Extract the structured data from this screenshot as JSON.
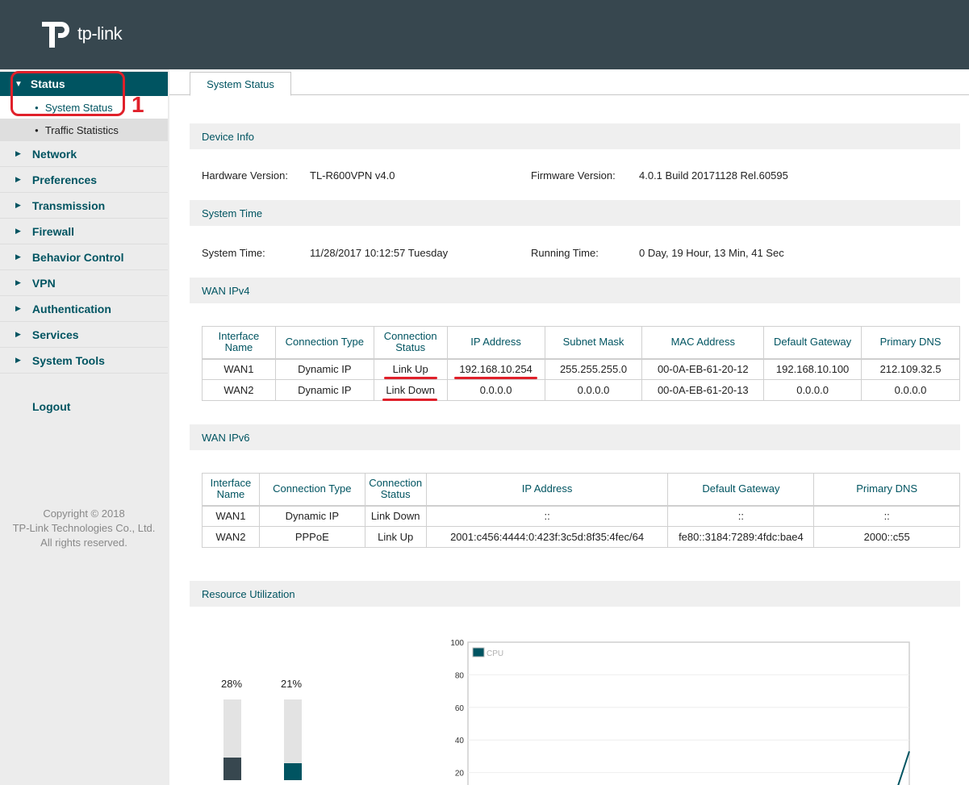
{
  "brand": {
    "name": "tp-link"
  },
  "sidebar": {
    "status": {
      "label": "Status",
      "items": [
        {
          "label": "System Status"
        },
        {
          "label": "Traffic Statistics"
        }
      ]
    },
    "items": [
      {
        "label": "Network"
      },
      {
        "label": "Preferences"
      },
      {
        "label": "Transmission"
      },
      {
        "label": "Firewall"
      },
      {
        "label": "Behavior Control"
      },
      {
        "label": "VPN"
      },
      {
        "label": "Authentication"
      },
      {
        "label": "Services"
      },
      {
        "label": "System Tools"
      }
    ],
    "logout": "Logout",
    "copyright": [
      "Copyright © 2018",
      "TP-Link Technologies Co., Ltd.",
      "All rights reserved."
    ]
  },
  "annotation": {
    "number": "1",
    "color": "#e0202a"
  },
  "tabs": [
    {
      "label": "System Status"
    }
  ],
  "device_info": {
    "title": "Device Info",
    "hardware_label": "Hardware Version:",
    "hardware_value": "TL-R600VPN v4.0",
    "firmware_label": "Firmware Version:",
    "firmware_value": "4.0.1 Build 20171128 Rel.60595"
  },
  "system_time": {
    "title": "System Time",
    "time_label": "System Time:",
    "time_value": "11/28/2017 10:12:57 Tuesday",
    "running_label": "Running Time:",
    "running_value": "0 Day, 19 Hour, 13 Min, 41 Sec"
  },
  "wan_ipv4": {
    "title": "WAN IPv4",
    "headers": [
      [
        "Interface",
        "Name"
      ],
      [
        "Connection Type"
      ],
      [
        "Connection",
        "Status"
      ],
      [
        "IP Address"
      ],
      [
        "Subnet Mask"
      ],
      [
        "MAC Address"
      ],
      [
        "Default Gateway"
      ],
      [
        "Primary DNS"
      ]
    ],
    "rows": [
      [
        "WAN1",
        "Dynamic IP",
        "Link Up",
        "192.168.10.254",
        "255.255.255.0",
        "00-0A-EB-61-20-12",
        "192.168.10.100",
        "212.109.32.5"
      ],
      [
        "WAN2",
        "Dynamic IP",
        "Link Down",
        "0.0.0.0",
        "0.0.0.0",
        "00-0A-EB-61-20-13",
        "0.0.0.0",
        "0.0.0.0"
      ]
    ]
  },
  "wan_ipv6": {
    "title": "WAN IPv6",
    "headers": [
      [
        "Interface",
        "Name"
      ],
      [
        "Connection Type"
      ],
      [
        "Connection",
        "Status"
      ],
      [
        "IP Address"
      ],
      [
        "Default Gateway"
      ],
      [
        "Primary DNS"
      ]
    ],
    "rows": [
      [
        "WAN1",
        "Dynamic IP",
        "Link Down",
        "::",
        "::",
        "::"
      ],
      [
        "WAN2",
        "PPPoE",
        "Link Up",
        "2001:c456:4444:0:423f:3c5d:8f35:4fec/64",
        "fe80::3184:7289:4fdc:bae4",
        "2000::c55"
      ]
    ]
  },
  "resource": {
    "title": "Resource Utilization",
    "gauges": [
      {
        "label": "28%",
        "fraction": 0.28,
        "color": "#37474f"
      },
      {
        "label": "21%",
        "fraction": 0.21,
        "color": "#005461"
      }
    ]
  },
  "chart_data": {
    "type": "line",
    "title": "",
    "xlabel": "",
    "ylabel": "",
    "ylim": [
      0,
      100
    ],
    "yticks": [
      20,
      40,
      60,
      80,
      100
    ],
    "grid": true,
    "legend_position": "top-left",
    "series": [
      {
        "name": "CPU",
        "color": "#005461",
        "x": [
          0.96,
          1.0
        ],
        "values": [
          0,
          33
        ]
      }
    ]
  }
}
